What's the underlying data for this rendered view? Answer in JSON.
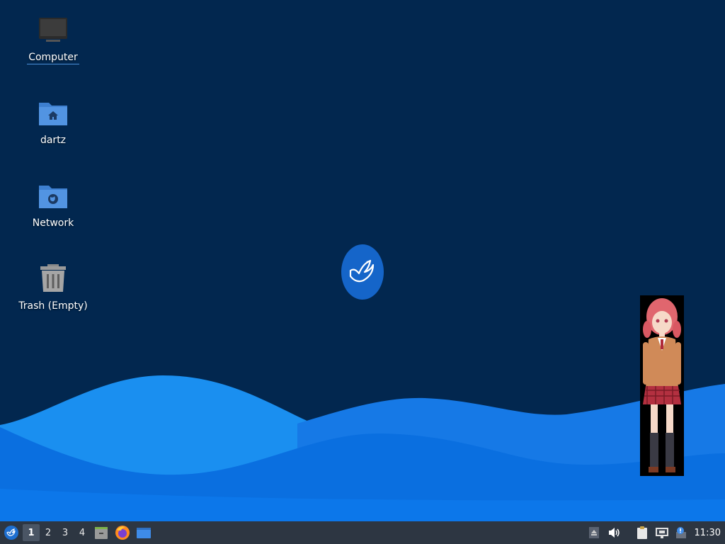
{
  "desktop": {
    "icons": [
      {
        "label": "Computer",
        "icon": "computer-icon"
      },
      {
        "label": "dartz",
        "icon": "home-folder-icon"
      },
      {
        "label": "Network",
        "icon": "network-folder-icon"
      },
      {
        "label": "Trash (Empty)",
        "icon": "trash-icon"
      }
    ],
    "colors": {
      "background": "#02274f",
      "wave_light": "#1e9bf0",
      "wave_mid": "#0a78e0",
      "wave_dark": "#0868d2"
    }
  },
  "panel": {
    "start_icon": "distro-logo-icon",
    "workspaces": [
      "1",
      "2",
      "3",
      "4"
    ],
    "active_workspace": "1",
    "launchers": [
      {
        "name": "file-manager",
        "icon": "file-manager-icon"
      },
      {
        "name": "firefox",
        "icon": "firefox-icon"
      },
      {
        "name": "show-desktop",
        "icon": "show-desktop-icon"
      }
    ],
    "tray": [
      {
        "name": "eject",
        "icon": "eject-icon"
      },
      {
        "name": "volume",
        "icon": "volume-icon"
      },
      {
        "name": "clipboard",
        "icon": "clipboard-icon"
      },
      {
        "name": "network",
        "icon": "network-wired-icon"
      },
      {
        "name": "updates",
        "icon": "update-notifier-icon"
      }
    ],
    "clock": "11:30",
    "colors": {
      "background": "#2d3642"
    }
  }
}
